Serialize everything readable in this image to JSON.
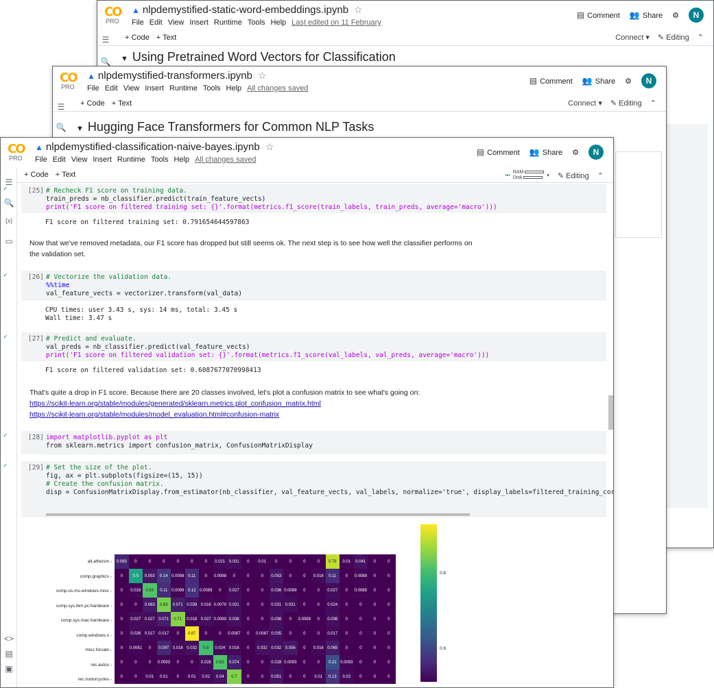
{
  "logo": {
    "co": "CO",
    "pro": "PRO"
  },
  "menus": [
    "File",
    "Edit",
    "View",
    "Insert",
    "Runtime",
    "Tools",
    "Help"
  ],
  "top_actions": {
    "comment": "Comment",
    "share": "Share",
    "avatar": "N"
  },
  "toolbar": {
    "code": "+ Code",
    "text": "+ Text",
    "connect": "Connect",
    "editing": "Editing",
    "ram": "RAM",
    "disk": "Disk"
  },
  "window1": {
    "title": "nlpdemystified-static-word-embeddings.ipynb",
    "saved": "Last edited on 11 February",
    "heading": "Using Pretrained Word Vectors for Classification"
  },
  "window2": {
    "title": "nlpdemystified-transformers.ipynb",
    "saved": "All changes saved",
    "heading": "Hugging Face Transformers for Common NLP Tasks"
  },
  "window3": {
    "title": "nlpdemystified-classification-naive-bayes.ipynb",
    "saved": "All changes saved",
    "cells": [
      {
        "num": "[25]",
        "lines": [
          "# Recheck F1 score on training data.",
          "train_preds = nb_classifier.predict(train_feature_vects)",
          "print('F1 score on filtered training set: {}'.format(metrics.f1_score(train_labels, train_preds, average='macro')))"
        ],
        "output": "F1 score on filtered training set: 0.791654644597863"
      },
      {
        "num": "[26]",
        "lines": [
          "# Vectorize the validation data.",
          "%%time",
          "val_feature_vects = vectorizer.transform(val_data)"
        ],
        "output": "CPU times: user 3.43 s, sys: 14 ms, total: 3.45 s\nWall time: 3.47 s"
      },
      {
        "num": "[27]",
        "lines": [
          "# Predict and evaluate.",
          "val_preds = nb_classifier.predict(val_feature_vects)",
          "print('F1 score on filtered validation set: {}'.format(metrics.f1_score(val_labels, val_preds, average='macro')))"
        ],
        "output": "F1 score on filtered validation set: 0.6087677070998413"
      },
      {
        "num": "[28]",
        "lines": [
          "import matplotlib.pyplot as plt",
          "from sklearn.metrics import confusion_matrix, ConfusionMatrixDisplay"
        ],
        "output": ""
      },
      {
        "num": "[29]",
        "lines": [
          "# Set the size of the plot.",
          "fig, ax = plt.subplots(figsize=(15, 15))",
          "",
          "# Create the confusion matrix.",
          "disp = ConfusionMatrixDisplay.from_estimator(nb_classifier, val_feature_vects, val_labels, normalize='true', display_labels=filtered_training_corpus.target"
        ],
        "output": ""
      }
    ],
    "md1": "Now that we've removed metadata, our F1 score has dropped but still seems ok. The next step is to see how well the classifier performs on the validation set.",
    "md2": "That's quite a drop in F1 score. Because there are 20 classes involved, let's plot a confusion matrix to see what's going on:",
    "link1": "https://scikit-learn.org/stable/modules/generated/sklearn.metrics.plot_confusion_matrix.html",
    "link2": "https://scikit-learn.org/stable/modules/model_evaluation.html#confusion-matrix"
  },
  "chart_data": {
    "type": "heatmap",
    "rows": [
      "alt.atheism",
      "comp.graphics",
      "comp.os.ms-windows.misc",
      "comp.sys.ibm.pc.hardware",
      "comp.sys.mac.hardware",
      "comp.windows.x",
      "misc.forsale",
      "rec.autos",
      "rec.motorcycles"
    ],
    "values": [
      [
        "0.093",
        "0",
        "0",
        "0",
        "0",
        "0",
        "0",
        "0.021",
        "0.031",
        "0",
        "0.01",
        "0",
        "0",
        "0",
        "0",
        "0.79",
        "0.01",
        "0.041",
        "0",
        "0"
      ],
      [
        "0",
        "0.5",
        "0.053",
        "0.14",
        "0.0088",
        "0.11",
        "0",
        "0.0088",
        "0",
        "0",
        "0",
        "0.053",
        "0",
        "0",
        "0.018",
        "0.11",
        "0",
        "0.0088",
        "0",
        "0"
      ],
      [
        "0",
        "0.018",
        "0.63",
        "0.11",
        "0.0089",
        "0.12",
        "0.0089",
        "0",
        "0.027",
        "0",
        "0",
        "0.036",
        "0.0089",
        "0",
        "0",
        "0.027",
        "0",
        "0.0089",
        "0",
        "0"
      ],
      [
        "0",
        "0",
        "0.063",
        "0.69",
        "0.071",
        "0.039",
        "0.016",
        "0.0079",
        "0.031",
        "0",
        "0",
        "0.031",
        "0.031",
        "0",
        "0",
        "0.024",
        "0",
        "0",
        "0",
        "0"
      ],
      [
        "0",
        "0.027",
        "0.027",
        "0.071",
        "0.71",
        "0.018",
        "0.027",
        "0.0089",
        "0.036",
        "0",
        "0",
        "0.036",
        "0",
        "0.0089",
        "0",
        "0.036",
        "0",
        "0",
        "0",
        "0"
      ],
      [
        "0",
        "0.026",
        "0.017",
        "0.017",
        "0",
        "0.87",
        "0",
        "0",
        "0.0087",
        "0",
        "0.0087",
        "0.035",
        "0",
        "0",
        "0",
        "0.017",
        "0",
        "0",
        "0",
        "0"
      ],
      [
        "0",
        "0.0081",
        "0",
        "0.097",
        "0.016",
        "0.032",
        "0.6",
        "0.024",
        "0.016",
        "0",
        "0.032",
        "0.032",
        "0.056",
        "0",
        "0.016",
        "0.065",
        "0",
        "0",
        "0",
        "0"
      ],
      [
        "0",
        "0",
        "0",
        "0.0093",
        "0",
        "0",
        "0.028",
        "0.63",
        "0.074",
        "0",
        "0",
        "0.028",
        "0.0093",
        "0",
        "0",
        "0.21",
        "0.0093",
        "0",
        "0",
        "0"
      ],
      [
        "0",
        "0",
        "0.01",
        "0.01",
        "0",
        "0.01",
        "0.02",
        "0.04",
        "0.7",
        "0",
        "0",
        "0.051",
        "0",
        "0",
        "0.01",
        "0.13",
        "0.02",
        "0",
        "0",
        "0"
      ]
    ],
    "colorbar_ticks": [
      "0.8",
      "0.6"
    ],
    "colormap": "viridis"
  }
}
